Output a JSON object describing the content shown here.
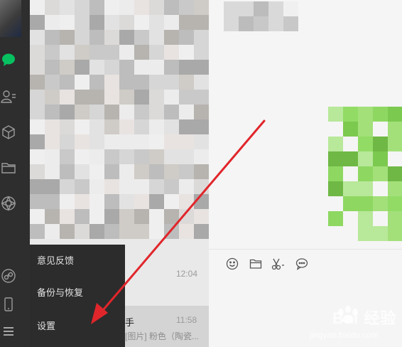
{
  "nav": {
    "icons": [
      "chat-bubble-icon",
      "contacts-icon",
      "cube-icon",
      "folder-icon",
      "moments-icon",
      "mini-program-icon",
      "phone-icon",
      "menu-icon"
    ],
    "active_color": "#07c160"
  },
  "conversations": {
    "times": [
      "12:04",
      "11:58"
    ],
    "selected_name": "手",
    "selected_preview": "[图片] 粉色（陶瓷..."
  },
  "menu": {
    "items": [
      "意见反馈",
      "备份与恢复",
      "设置"
    ]
  },
  "toolbar": {
    "icons": [
      "emoji-icon",
      "folder-icon",
      "scissors-icon",
      "chat-history-icon"
    ]
  },
  "watermark": {
    "brand": "Bai 经验",
    "url": "jingyan.baidu.com"
  },
  "colors": {
    "nav_bg": "#2e2e2e",
    "menu_bg": "#2c2c2c",
    "list_bg": "#e9e9e9",
    "chat_bg": "#f5f5f5",
    "arrow": "#e0262b",
    "image_green": "#8ed862"
  }
}
